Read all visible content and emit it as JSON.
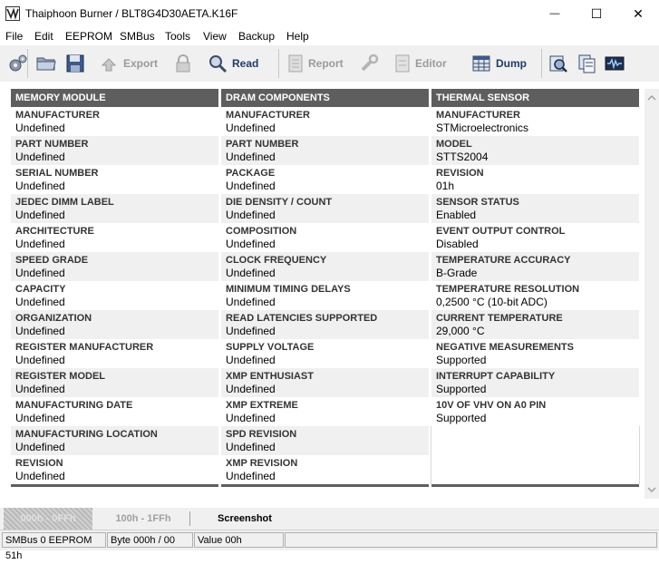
{
  "window": {
    "title": "Thaiphoon Burner / BLT8G4D30AETA.K16F",
    "minimize_glyph": "—",
    "maximize_glyph": "☐",
    "close_glyph": "✕"
  },
  "menu": [
    "File",
    "Edit",
    "EEPROM",
    "SMBus",
    "Tools",
    "View",
    "Backup",
    "Help"
  ],
  "toolbar": {
    "export_label": "Export",
    "read_label": "Read",
    "report_label": "Report",
    "editor_label": "Editor",
    "dump_label": "Dump"
  },
  "columns": [
    {
      "header": "MEMORY MODULE",
      "rows": [
        {
          "k": "MANUFACTURER",
          "v": "Undefined"
        },
        {
          "k": "PART NUMBER",
          "v": "Undefined"
        },
        {
          "k": "SERIAL NUMBER",
          "v": "Undefined"
        },
        {
          "k": "JEDEC DIMM LABEL",
          "v": "Undefined"
        },
        {
          "k": "ARCHITECTURE",
          "v": "Undefined"
        },
        {
          "k": "SPEED GRADE",
          "v": "Undefined"
        },
        {
          "k": "CAPACITY",
          "v": "Undefined"
        },
        {
          "k": "ORGANIZATION",
          "v": "Undefined"
        },
        {
          "k": "REGISTER MANUFACTURER",
          "v": "Undefined"
        },
        {
          "k": "REGISTER MODEL",
          "v": "Undefined"
        },
        {
          "k": "MANUFACTURING DATE",
          "v": "Undefined"
        },
        {
          "k": "MANUFACTURING LOCATION",
          "v": "Undefined"
        },
        {
          "k": "REVISION",
          "v": "Undefined"
        }
      ]
    },
    {
      "header": "DRAM COMPONENTS",
      "rows": [
        {
          "k": "MANUFACTURER",
          "v": "Undefined"
        },
        {
          "k": "PART NUMBER",
          "v": "Undefined"
        },
        {
          "k": "PACKAGE",
          "v": "Undefined"
        },
        {
          "k": "DIE DENSITY / COUNT",
          "v": "Undefined"
        },
        {
          "k": "COMPOSITION",
          "v": "Undefined"
        },
        {
          "k": "CLOCK FREQUENCY",
          "v": "Undefined"
        },
        {
          "k": "MINIMUM TIMING DELAYS",
          "v": "Undefined"
        },
        {
          "k": "READ LATENCIES SUPPORTED",
          "v": "Undefined"
        },
        {
          "k": "SUPPLY VOLTAGE",
          "v": "Undefined"
        },
        {
          "k": "XMP ENTHUSIAST",
          "v": "Undefined"
        },
        {
          "k": "XMP EXTREME",
          "v": "Undefined"
        },
        {
          "k": "SPD REVISION",
          "v": "Undefined"
        },
        {
          "k": "XMP REVISION",
          "v": "Undefined"
        }
      ]
    },
    {
      "header": "THERMAL SENSOR",
      "rows": [
        {
          "k": "MANUFACTURER",
          "v": "STMicroelectronics"
        },
        {
          "k": "MODEL",
          "v": "STTS2004"
        },
        {
          "k": "REVISION",
          "v": "01h"
        },
        {
          "k": "SENSOR STATUS",
          "v": "Enabled"
        },
        {
          "k": "EVENT OUTPUT CONTROL",
          "v": "Disabled"
        },
        {
          "k": "TEMPERATURE ACCURACY",
          "v": "B-Grade"
        },
        {
          "k": "TEMPERATURE RESOLUTION",
          "v": "0,2500 °C (10-bit ADC)"
        },
        {
          "k": "CURRENT TEMPERATURE",
          "v": "29,000 °C"
        },
        {
          "k": "NEGATIVE MEASUREMENTS",
          "v": "Supported"
        },
        {
          "k": "INTERRUPT CAPABILITY",
          "v": "Supported"
        },
        {
          "k": "10V OF VHV ON A0 PIN",
          "v": "Supported"
        },
        {
          "k": "",
          "v": ""
        },
        {
          "k": "",
          "v": ""
        }
      ]
    }
  ],
  "tabs": [
    {
      "label": "000h - 0FFh",
      "active": false
    },
    {
      "label": "100h - 1FFh",
      "active": false
    },
    {
      "label": "Screenshot",
      "active": true
    }
  ],
  "status": {
    "smbus": "SMBus 0 EEPROM 51h",
    "byte": "Byte 000h / 00",
    "value": "Value 00h",
    "extra": ""
  },
  "colors": {
    "header_bg": "#5e5e5e",
    "alt_row": "#f0f0f0",
    "toolbar_label": "#1f3b6a",
    "disabled_label": "#9a9a9a"
  }
}
